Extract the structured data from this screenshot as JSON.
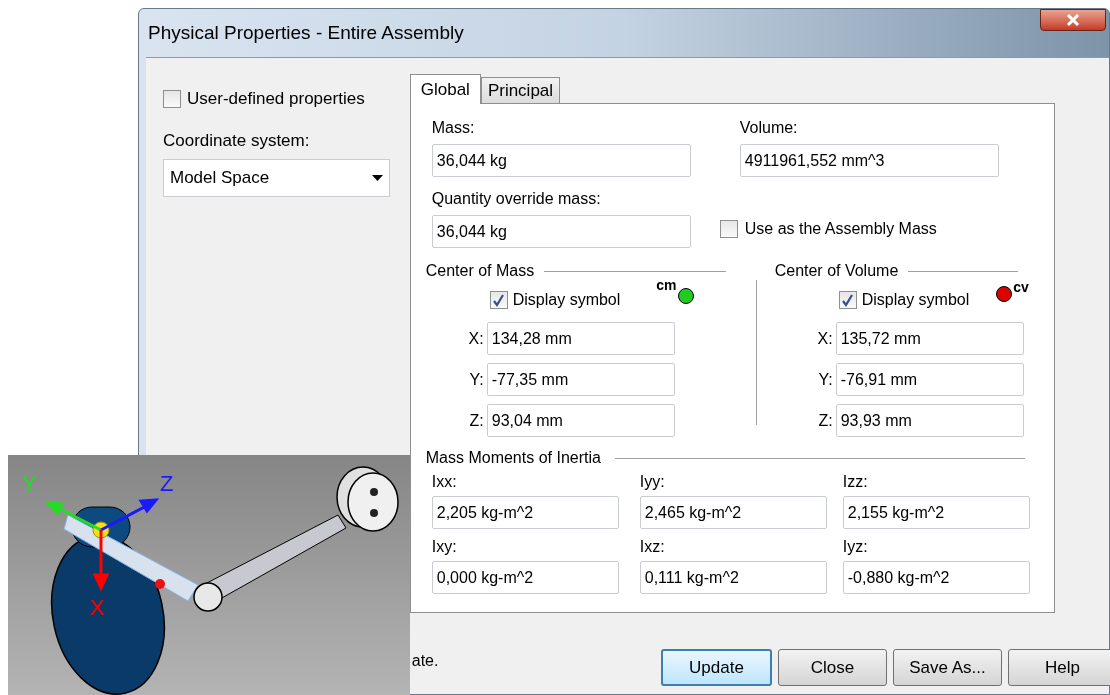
{
  "window": {
    "title": "Physical Properties - Entire Assembly"
  },
  "options": {
    "user_defined": {
      "label": "User-defined properties",
      "checked": false
    },
    "coordinate_label": "Coordinate system:",
    "coordinate_value": "Model Space"
  },
  "tabs": [
    {
      "label": "Global",
      "selected": true
    },
    {
      "label": "Principal",
      "selected": false
    }
  ],
  "mass": {
    "label": "Mass:",
    "value": "36,044 kg"
  },
  "volume": {
    "label": "Volume:",
    "value": "4911961,552 mm^3"
  },
  "override": {
    "label": "Quantity override mass:",
    "value": "36,044 kg"
  },
  "use_assembly": {
    "label": "Use as the Assembly Mass",
    "checked": false
  },
  "centers": [
    {
      "kind": "mass",
      "title": "Center of Mass",
      "display": {
        "label": "Display symbol",
        "checked": true
      },
      "symbol": "cm",
      "color": "#1fcc1f",
      "coords": [
        {
          "axis": "X:",
          "value": "134,28 mm"
        },
        {
          "axis": "Y:",
          "value": "-77,35 mm"
        },
        {
          "axis": "Z:",
          "value": "93,04 mm"
        }
      ]
    },
    {
      "kind": "volume",
      "title": "Center of Volume",
      "display": {
        "label": "Display symbol",
        "checked": true
      },
      "symbol": "cv",
      "color": "#dd0000",
      "coords": [
        {
          "axis": "X:",
          "value": "135,72 mm"
        },
        {
          "axis": "Y:",
          "value": "-76,91 mm"
        },
        {
          "axis": "Z:",
          "value": "93,93 mm"
        }
      ]
    }
  ],
  "inertia": {
    "title": "Mass Moments of Inertia",
    "cells": [
      {
        "label": "Ixx:",
        "value": "2,205 kg-m^2"
      },
      {
        "label": "Iyy:",
        "value": "2,465 kg-m^2"
      },
      {
        "label": "Izz:",
        "value": "2,155 kg-m^2"
      },
      {
        "label": "Ixy:",
        "value": "0,000 kg-m^2"
      },
      {
        "label": "Ixz:",
        "value": "0,111 kg-m^2"
      },
      {
        "label": "Iyz:",
        "value": "-0,880 kg-m^2"
      }
    ]
  },
  "status_text": "ate.",
  "buttons": [
    {
      "label": "Update",
      "default": true
    },
    {
      "label": "Close",
      "default": false
    },
    {
      "label": "Save As...",
      "default": false
    },
    {
      "label": "Help",
      "default": false
    }
  ],
  "viewport": {
    "axes": [
      {
        "kind": "y",
        "label": "Y"
      },
      {
        "kind": "z",
        "label": "Z"
      },
      {
        "kind": "x",
        "label": "X"
      }
    ]
  }
}
